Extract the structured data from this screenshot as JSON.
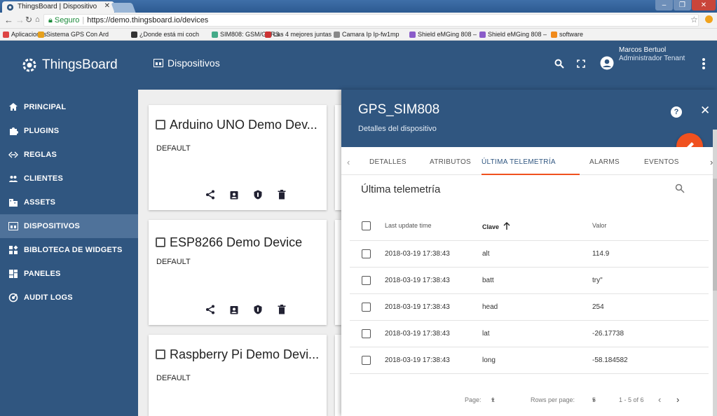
{
  "browser": {
    "tab_title": "ThingsBoard | Dispositivo",
    "tab_close": "✕",
    "window_min": "–",
    "window_max": "❐",
    "window_close": "✕",
    "secure_label": "Seguro",
    "url": "https://demo.thingsboard.io/devices"
  },
  "bookmarks": [
    {
      "label": "Aplicaciones",
      "color": "#d44"
    },
    {
      "label": "Sistema GPS Con Ard",
      "color": "#e6a01c"
    },
    {
      "label": "¿Donde está mi coch",
      "color": "#333"
    },
    {
      "label": "SIM808: GSM/GPRS -",
      "color": "#4a8"
    },
    {
      "label": "Las 4 mejores juntas",
      "color": "#c33"
    },
    {
      "label": "Camara Ip Ip-fw1mp",
      "color": "#888"
    },
    {
      "label": "Shield eMGing 808 –",
      "color": "#8a5cc9"
    },
    {
      "label": "Shield eMGing 808 –",
      "color": "#8a5cc9"
    },
    {
      "label": "software",
      "color": "#f08a1c"
    }
  ],
  "app": {
    "brand": "ThingsBoard",
    "page_title": "Dispositivos",
    "user_name": "Marcos Bertuol",
    "user_role": "Administrador Tenant"
  },
  "sidebar": {
    "items": [
      {
        "label": "PRINCIPAL",
        "icon": "home-icon"
      },
      {
        "label": "PLUGINS",
        "icon": "puzzle-icon"
      },
      {
        "label": "REGLAS",
        "icon": "code-arrows-icon"
      },
      {
        "label": "CLIENTES",
        "icon": "people-icon"
      },
      {
        "label": "ASSETS",
        "icon": "domain-icon"
      },
      {
        "label": "DISPOSITIVOS",
        "icon": "devices-icon",
        "active": true
      },
      {
        "label": "BIBLOTECA DE WIDGETS",
        "icon": "widgets-icon"
      },
      {
        "label": "PANELES",
        "icon": "dashboards-icon"
      },
      {
        "label": "AUDIT LOGS",
        "icon": "track-changes-icon"
      }
    ]
  },
  "devices": [
    {
      "name": "Arduino UNO Demo Dev...",
      "type": "DEFAULT"
    },
    {
      "name": "ESP8266 Demo Device",
      "type": "DEFAULT"
    },
    {
      "name": "Raspberry Pi Demo Devi...",
      "type": "DEFAULT"
    }
  ],
  "detail": {
    "device_name": "GPS_SIM808",
    "subtitle": "Detalles del dispositivo",
    "help": "?",
    "close": "✕",
    "tabs": [
      "DETALLES",
      "ATRIBUTOS",
      "ÚLTIMA TELEMETRÍA",
      "ALARMS",
      "EVENTOS"
    ],
    "active_tab": "ÚLTIMA TELEMETRÍA",
    "section_title": "Última telemetría",
    "columns": {
      "time": "Last update time",
      "key": "Clave",
      "value": "Valor"
    },
    "rows": [
      {
        "time": "2018-03-19 17:38:43",
        "key": "alt",
        "value": "114.9"
      },
      {
        "time": "2018-03-19 17:38:43",
        "key": "batt",
        "value": "try\""
      },
      {
        "time": "2018-03-19 17:38:43",
        "key": "head",
        "value": "254"
      },
      {
        "time": "2018-03-19 17:38:43",
        "key": "lat",
        "value": "-26.17738"
      },
      {
        "time": "2018-03-19 17:38:43",
        "key": "long",
        "value": "-58.184582"
      }
    ],
    "pager": {
      "page_label": "Page:",
      "page": "1",
      "rows_label": "Rows per page:",
      "rows_per_page": "5",
      "range": "1 - 5 of 6"
    }
  }
}
